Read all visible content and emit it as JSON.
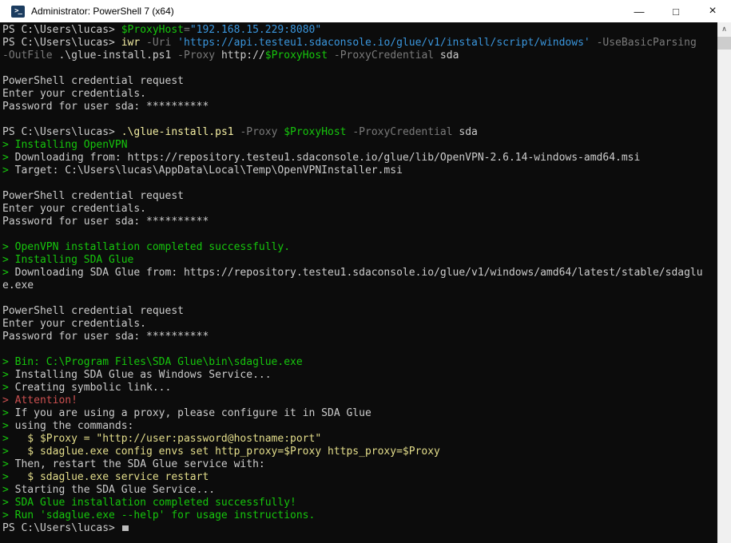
{
  "window": {
    "title": "Administrator: PowerShell 7 (x64)",
    "icon_glyph": ">_",
    "controls": {
      "minimize": "—",
      "maximize": "□",
      "close": "×"
    }
  },
  "palette": {
    "bg": "#0c0c0c",
    "fg": "#cccccc",
    "cmd": "#f5efa3",
    "param": "#7a7a7a",
    "str": "#3a96dd",
    "var": "#16c60c",
    "green": "#16c60c",
    "red": "#cc5050",
    "warn": "#e4de8b"
  },
  "terminal": {
    "prompt": "PS C:\\Users\\lucas> ",
    "lines": [
      {
        "s": [
          {
            "t": "PS C:\\Users\\lucas> ",
            "c": "fg"
          },
          {
            "t": "$ProxyHost",
            "c": "var"
          },
          {
            "t": "=",
            "c": "param"
          },
          {
            "t": "\"192.168.15.229:8080\"",
            "c": "str"
          }
        ]
      },
      {
        "s": [
          {
            "t": "PS C:\\Users\\lucas> ",
            "c": "fg"
          },
          {
            "t": "iwr",
            "c": "cmd"
          },
          {
            "t": " ",
            "c": "fg"
          },
          {
            "t": "-Uri",
            "c": "param"
          },
          {
            "t": " ",
            "c": "fg"
          },
          {
            "t": "'https://api.testeu1.sdaconsole.io/glue/v1/install/script/windows'",
            "c": "str"
          },
          {
            "t": " ",
            "c": "fg"
          },
          {
            "t": "-UseBasicParsing",
            "c": "param"
          }
        ]
      },
      {
        "s": [
          {
            "t": "-OutFile",
            "c": "param"
          },
          {
            "t": " .\\glue-install.ps1 ",
            "c": "fg"
          },
          {
            "t": "-Proxy",
            "c": "param"
          },
          {
            "t": " http://",
            "c": "fg"
          },
          {
            "t": "$ProxyHost",
            "c": "var"
          },
          {
            "t": " ",
            "c": "fg"
          },
          {
            "t": "-ProxyCredential",
            "c": "param"
          },
          {
            "t": " sda",
            "c": "fg"
          }
        ]
      },
      {
        "s": []
      },
      {
        "s": [
          {
            "t": "PowerShell credential request",
            "c": "fg"
          }
        ]
      },
      {
        "s": [
          {
            "t": "Enter your credentials.",
            "c": "fg"
          }
        ]
      },
      {
        "s": [
          {
            "t": "Password for user sda: **********",
            "c": "fg"
          }
        ]
      },
      {
        "s": []
      },
      {
        "s": [
          {
            "t": "PS C:\\Users\\lucas> ",
            "c": "fg"
          },
          {
            "t": ".\\glue-install.ps1",
            "c": "cmd"
          },
          {
            "t": " ",
            "c": "fg"
          },
          {
            "t": "-Proxy",
            "c": "param"
          },
          {
            "t": " ",
            "c": "fg"
          },
          {
            "t": "$ProxyHost",
            "c": "var"
          },
          {
            "t": " ",
            "c": "fg"
          },
          {
            "t": "-ProxyCredential",
            "c": "param"
          },
          {
            "t": " sda",
            "c": "fg"
          }
        ]
      },
      {
        "s": [
          {
            "t": "> Installing OpenVPN",
            "c": "green"
          }
        ]
      },
      {
        "s": [
          {
            "t": "> ",
            "c": "green"
          },
          {
            "t": "Downloading from: https://repository.testeu1.sdaconsole.io/glue/lib/OpenVPN-2.6.14-windows-amd64.msi",
            "c": "fg"
          }
        ]
      },
      {
        "s": [
          {
            "t": "> ",
            "c": "green"
          },
          {
            "t": "Target: C:\\Users\\lucas\\AppData\\Local\\Temp\\OpenVPNInstaller.msi",
            "c": "fg"
          }
        ]
      },
      {
        "s": []
      },
      {
        "s": [
          {
            "t": "PowerShell credential request",
            "c": "fg"
          }
        ]
      },
      {
        "s": [
          {
            "t": "Enter your credentials.",
            "c": "fg"
          }
        ]
      },
      {
        "s": [
          {
            "t": "Password for user sda: **********",
            "c": "fg"
          }
        ]
      },
      {
        "s": []
      },
      {
        "s": [
          {
            "t": "> OpenVPN installation completed successfully.",
            "c": "green"
          }
        ]
      },
      {
        "s": [
          {
            "t": "> Installing SDA Glue",
            "c": "green"
          }
        ]
      },
      {
        "s": [
          {
            "t": "> ",
            "c": "green"
          },
          {
            "t": "Downloading SDA Glue from: https://repository.testeu1.sdaconsole.io/glue/v1/windows/amd64/latest/stable/sdaglu",
            "c": "fg"
          }
        ]
      },
      {
        "s": [
          {
            "t": "e.exe",
            "c": "fg"
          }
        ]
      },
      {
        "s": []
      },
      {
        "s": [
          {
            "t": "PowerShell credential request",
            "c": "fg"
          }
        ]
      },
      {
        "s": [
          {
            "t": "Enter your credentials.",
            "c": "fg"
          }
        ]
      },
      {
        "s": [
          {
            "t": "Password for user sda: **********",
            "c": "fg"
          }
        ]
      },
      {
        "s": []
      },
      {
        "s": [
          {
            "t": "> Bin: C:\\Program Files\\SDA Glue\\bin\\sdaglue.exe",
            "c": "green"
          }
        ]
      },
      {
        "s": [
          {
            "t": "> ",
            "c": "green"
          },
          {
            "t": "Installing SDA Glue as Windows Service...",
            "c": "fg"
          }
        ]
      },
      {
        "s": [
          {
            "t": "> ",
            "c": "green"
          },
          {
            "t": "Creating symbolic link...",
            "c": "fg"
          }
        ]
      },
      {
        "s": [
          {
            "t": "> Attention!",
            "c": "red"
          }
        ]
      },
      {
        "s": [
          {
            "t": "> ",
            "c": "green"
          },
          {
            "t": "If you are using a proxy, please configure it in SDA Glue",
            "c": "fg"
          }
        ]
      },
      {
        "s": [
          {
            "t": "> ",
            "c": "green"
          },
          {
            "t": "using the commands:",
            "c": "fg"
          }
        ]
      },
      {
        "s": [
          {
            "t": "> ",
            "c": "green"
          },
          {
            "t": "  $ $Proxy = \"http://user:password@hostname:port\"",
            "c": "warn"
          }
        ]
      },
      {
        "s": [
          {
            "t": "> ",
            "c": "green"
          },
          {
            "t": "  $ sdaglue.exe config envs set http_proxy=$Proxy https_proxy=$Proxy",
            "c": "warn"
          }
        ]
      },
      {
        "s": [
          {
            "t": "> ",
            "c": "green"
          },
          {
            "t": "Then, restart the SDA Glue service with:",
            "c": "fg"
          }
        ]
      },
      {
        "s": [
          {
            "t": "> ",
            "c": "green"
          },
          {
            "t": "  $ sdaglue.exe service restart",
            "c": "warn"
          }
        ]
      },
      {
        "s": [
          {
            "t": "> ",
            "c": "green"
          },
          {
            "t": "Starting the SDA Glue Service...",
            "c": "fg"
          }
        ]
      },
      {
        "s": [
          {
            "t": "> SDA Glue installation completed successfully!",
            "c": "green"
          }
        ]
      },
      {
        "s": [
          {
            "t": "> Run 'sdaglue.exe --help' for usage instructions.",
            "c": "green"
          }
        ]
      },
      {
        "s": [
          {
            "t": "PS C:\\Users\\lucas> ",
            "c": "fg"
          }
        ],
        "cursor": true
      }
    ]
  },
  "scrollbar": {
    "up_arrow": "∧"
  }
}
